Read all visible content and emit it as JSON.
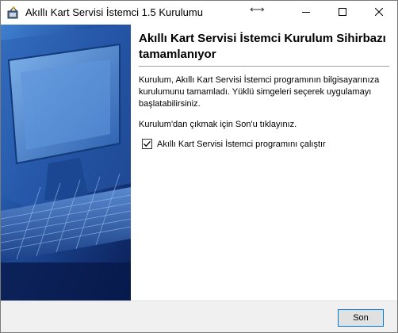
{
  "window": {
    "title": "Akıllı Kart Servisi İstemci 1.5 Kurulumu",
    "icon": "installer-icon",
    "controls": [
      "minimize-icon",
      "maximize-icon",
      "close-icon"
    ]
  },
  "content": {
    "heading_line1": "Akıllı Kart Servisi İstemci Kurulum Sihirbazı",
    "heading_line2": "tamamlanıyor",
    "para1_line1": "Kurulum, Akıllı Kart Servisi İstemci programının bilgisayarınıza",
    "para1_line2": "kurulumunu tamamladı. Yüklü simgeleri seçerek uygulamayı",
    "para1_line3": "başlatabilirsiniz.",
    "para2": "Kurulum'dan çıkmak için Son'u tıklayınız.",
    "checkbox_label": "Akıllı Kart Servisi İstemci programını çalıştır",
    "checkbox_checked": true
  },
  "footer": {
    "finish_label": "Son"
  },
  "colors": {
    "sidebar_dark": "#0e2a6d",
    "sidebar_light": "#3a79c8",
    "accent": "#0078d7"
  }
}
